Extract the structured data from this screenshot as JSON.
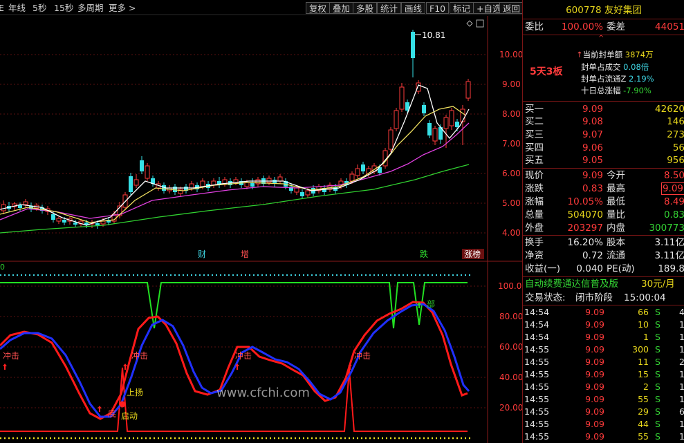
{
  "toolbar": {
    "left": [
      "年线",
      "5秒",
      "15秒",
      "多周期",
      "更多 >"
    ],
    "right": [
      "复权",
      "叠加",
      "多股",
      "统计",
      "画线",
      "F10",
      "标记",
      "+自选",
      "返回"
    ]
  },
  "chart": {
    "price_ticks": [
      "10.00",
      "9.00",
      "8.00",
      "7.00",
      "6.00",
      "5.00",
      "4.00"
    ],
    "ind_ticks": [
      "100.0",
      "80.00",
      "60.00",
      "40.00",
      "20.00"
    ],
    "high_label": "10.81",
    "events": [
      "财",
      "增",
      "跌",
      "涨榜"
    ],
    "ind_top_label": "0",
    "signals": [
      "冲击",
      "冲击",
      "冲击",
      "冲击",
      "底",
      "上扬",
      "启动",
      "部"
    ],
    "watermark": "www.cfchi.com"
  },
  "stock": {
    "code": "600778",
    "name": "友好集团"
  },
  "weibi": {
    "label": "委比",
    "value": "100.00%",
    "label2": "委差",
    "value2": "44051"
  },
  "streak": "5天3板",
  "seal": [
    {
      "label": "当前封单额",
      "value": "3874万"
    },
    {
      "label": "封单占成交",
      "value": "0.08倍"
    },
    {
      "label": "封单占流通Z",
      "value": "2.19%"
    },
    {
      "label": "十日总涨幅",
      "value": "-7.90%"
    }
  ],
  "bids": [
    {
      "label": "买一",
      "price": "9.09",
      "vol": "42620"
    },
    {
      "label": "买二",
      "price": "9.08",
      "vol": "146"
    },
    {
      "label": "买三",
      "price": "9.07",
      "vol": "273"
    },
    {
      "label": "买四",
      "price": "9.06",
      "vol": "56"
    },
    {
      "label": "买五",
      "price": "9.05",
      "vol": "956"
    }
  ],
  "quote": [
    {
      "l1": "现价",
      "v1": "9.09",
      "l2": "今开",
      "v2": "8.50"
    },
    {
      "l1": "涨跌",
      "v1": "0.83",
      "l2": "最高",
      "v2": "9.09"
    },
    {
      "l1": "涨幅",
      "v1": "10.05%",
      "l2": "最低",
      "v2": "8.49"
    },
    {
      "l1": "总量",
      "v1": "504070",
      "l2": "量比",
      "v2": "0.83"
    },
    {
      "l1": "外盘",
      "v1": "203297",
      "l2": "内盘",
      "v2": "300773"
    }
  ],
  "fund": [
    {
      "l1": "换手",
      "v1": "16.20%",
      "l2": "股本",
      "v2": "3.11亿"
    },
    {
      "l1": "净资",
      "v1": "0.72",
      "l2": "流通",
      "v2": "3.11亿"
    },
    {
      "l1": "收益(一)",
      "v1": "0.040",
      "l2": "PE(动)",
      "v2": "189.8"
    }
  ],
  "promo": {
    "text": "自动续费通达信普及版",
    "price": "30元/月"
  },
  "trade_state": {
    "label": "交易状态:",
    "value": "闭市阶段",
    "time": "15:00:04"
  },
  "ticks": [
    {
      "t": "14:54",
      "p": "9.09",
      "q": "66",
      "s": "S",
      "n": "4"
    },
    {
      "t": "14:54",
      "p": "9.09",
      "q": "10",
      "s": "S",
      "n": "1"
    },
    {
      "t": "14:54",
      "p": "9.09",
      "q": "1",
      "s": "S",
      "n": "1"
    },
    {
      "t": "14:55",
      "p": "9.09",
      "q": "300",
      "s": "S",
      "n": "1"
    },
    {
      "t": "14:55",
      "p": "9.09",
      "q": "11",
      "s": "S",
      "n": "2"
    },
    {
      "t": "14:55",
      "p": "9.09",
      "q": "15",
      "s": "S",
      "n": "1"
    },
    {
      "t": "14:55",
      "p": "9.09",
      "q": "2",
      "s": "S",
      "n": "1"
    },
    {
      "t": "14:55",
      "p": "9.09",
      "q": "55",
      "s": "S",
      "n": "1"
    },
    {
      "t": "14:55",
      "p": "9.09",
      "q": "29",
      "s": "S",
      "n": "6"
    },
    {
      "t": "14:55",
      "p": "9.09",
      "q": "44",
      "s": "S",
      "n": "1"
    },
    {
      "t": "14:55",
      "p": "9.09",
      "q": "55",
      "s": "S",
      "n": "1"
    }
  ],
  "colors": {
    "up": "#ff3b3b",
    "down": "#36e0e6",
    "ma5": "#ffffff",
    "ma10": "#f0e060",
    "ma20": "#e040e0",
    "ma60": "#30d030",
    "k": "#ff1a1a",
    "d": "#2030ff"
  }
}
